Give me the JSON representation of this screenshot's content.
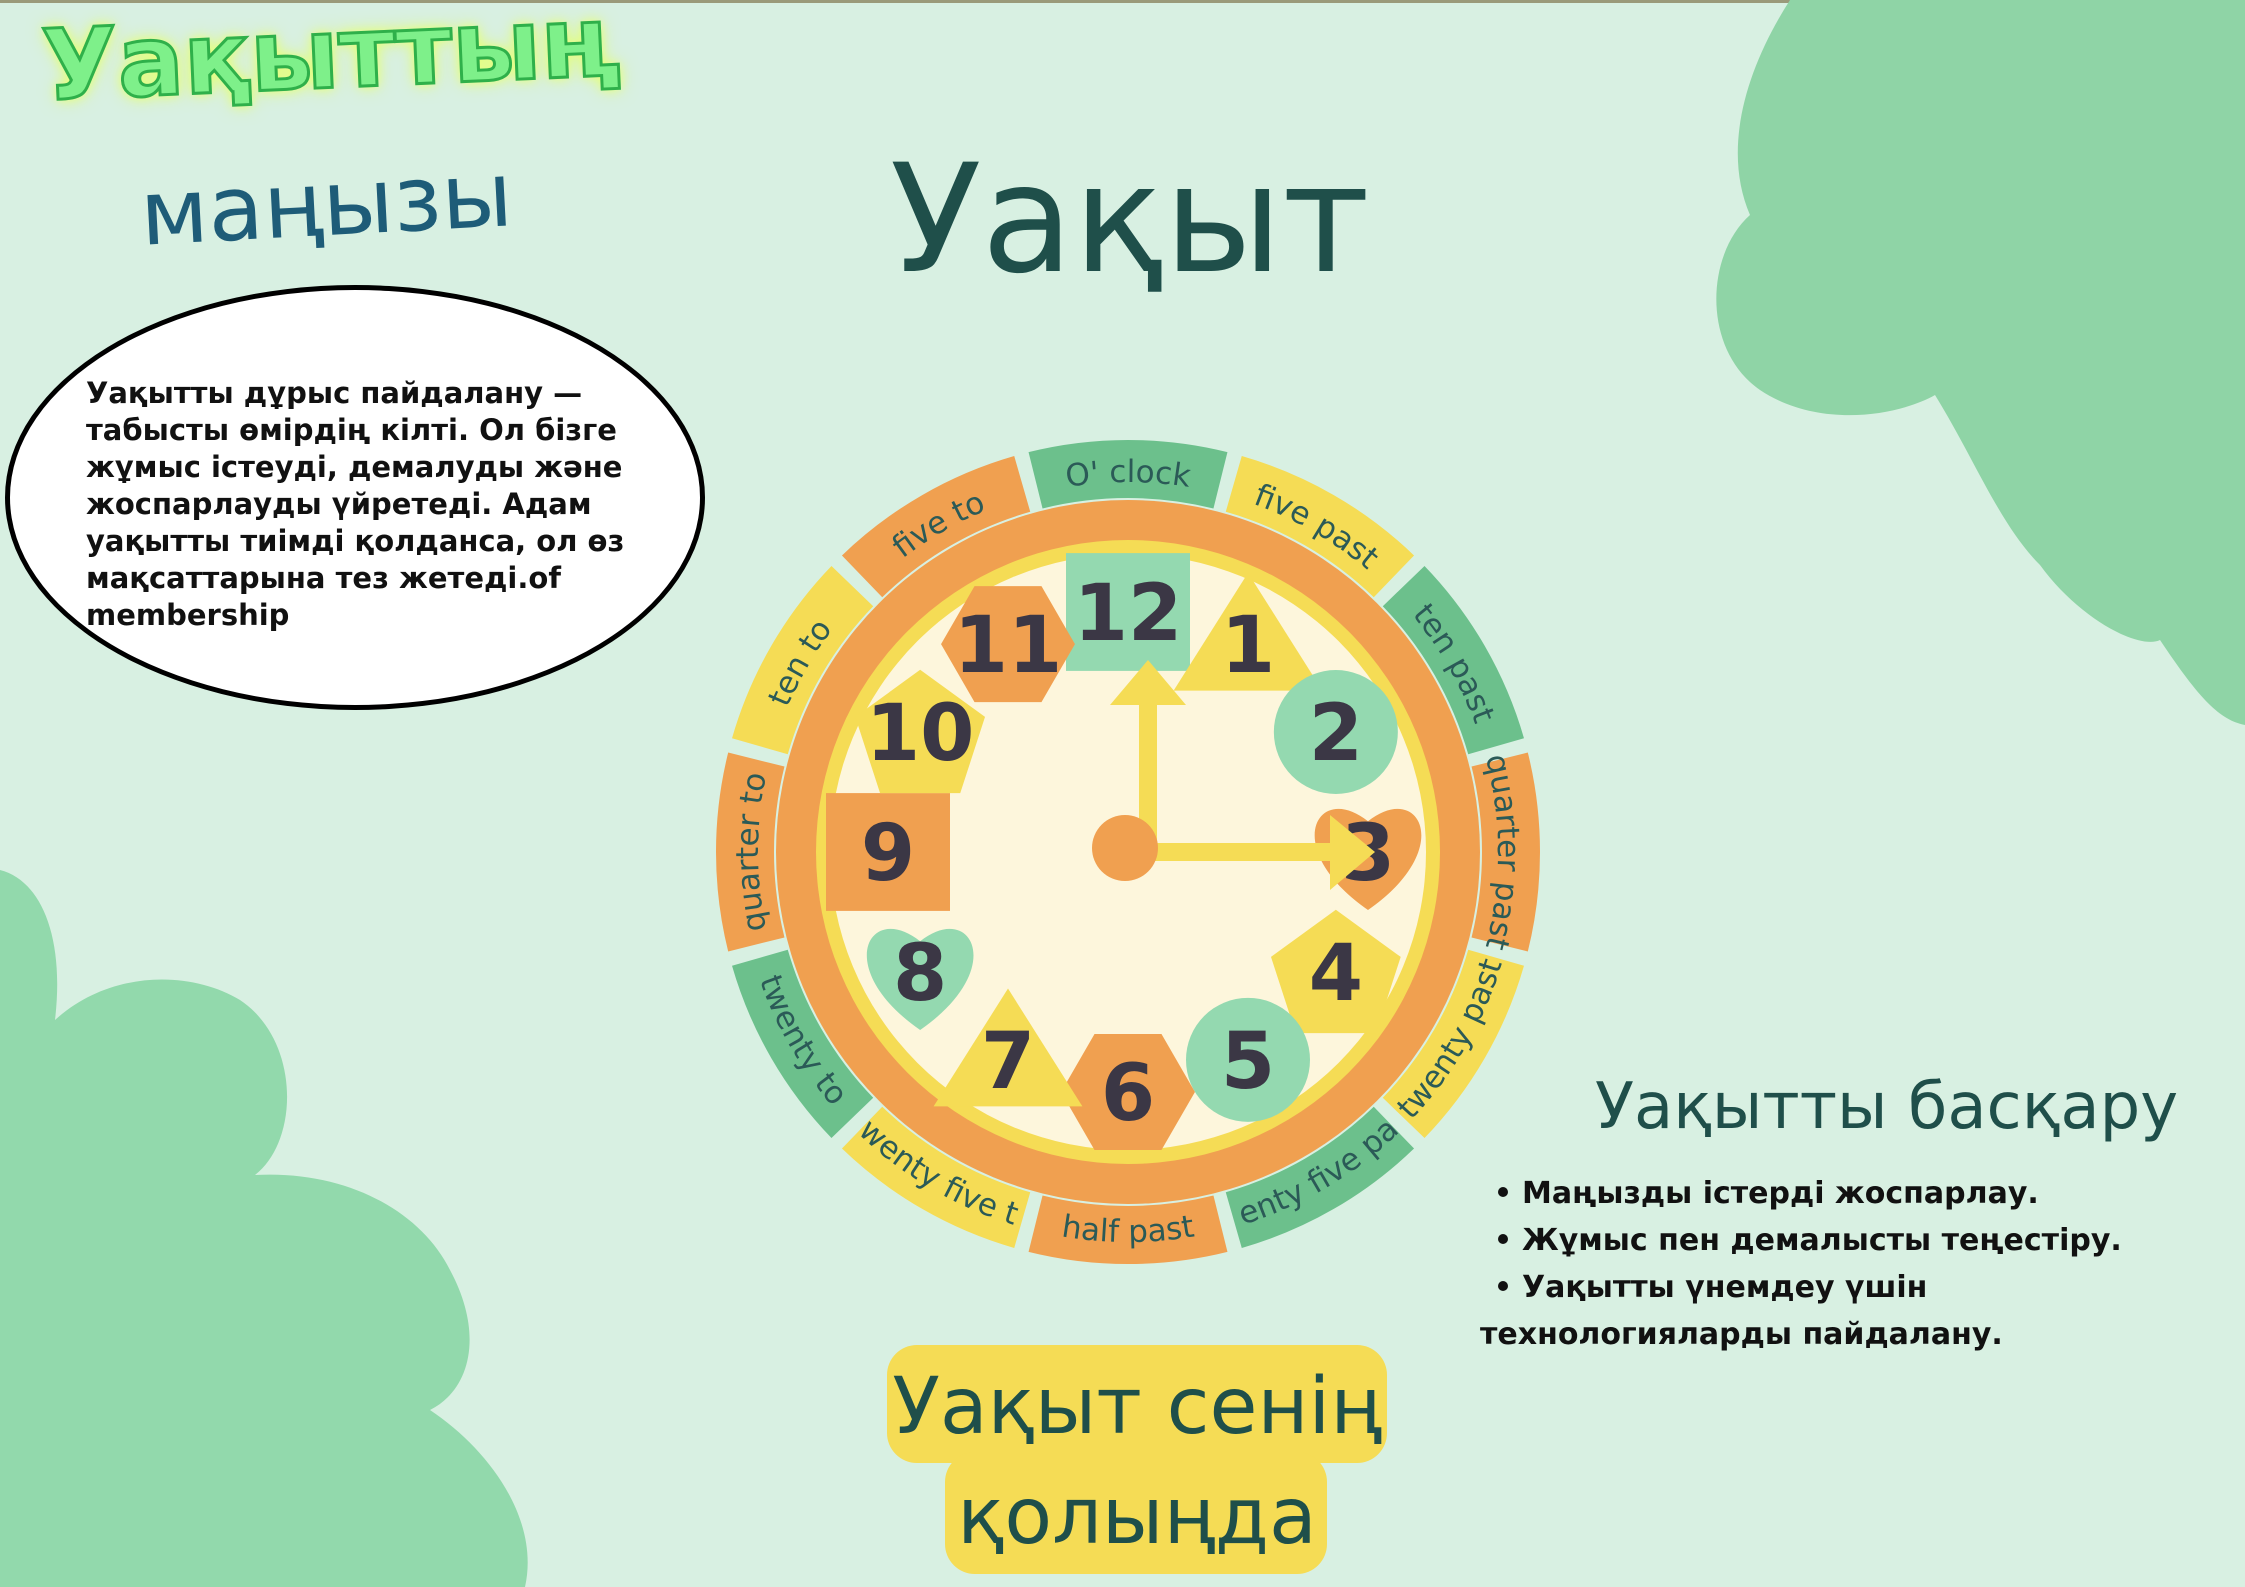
{
  "title": {
    "main": "Уақыттың",
    "sub": "маңызы"
  },
  "heading": "Уақыт",
  "bubble": {
    "text": "Уақытты дұрыс пайдалану — табысты өмірдің кілті. Ол бізге жұмыс істеуді, демалуды және жоспарлауды үйретеді. Адам уақытты тиімді қолданса, ол өз мақсаттарына тез жетеді.of membership"
  },
  "clock": {
    "segments": [
      "O' clock",
      "five past",
      "ten past",
      "quarter past",
      "twenty past",
      "twenty five past",
      "half past",
      "twenty five  to",
      "twenty to",
      "quarter to",
      "ten to",
      "five to"
    ],
    "numbers": [
      "12",
      "1",
      "2",
      "3",
      "4",
      "5",
      "6",
      "7",
      "8",
      "9",
      "10",
      "11"
    ],
    "hour_hand_points_to": 3,
    "minute_hand_points_to": 12
  },
  "management": {
    "heading": "Уақытты басқару",
    "items": [
      "Маңызды істерді жоспарлау.",
      "Жұмыс пен демалысты теңестіру.",
      "Уақытты үнемдеу үшін технологияларды пайдалану."
    ]
  },
  "slogan": {
    "line1": "Уақыт сенің",
    "line2": "қолыңда"
  },
  "colors": {
    "background": "#d8f0e2",
    "leaf": "#8fd4a6",
    "orange": "#f0a050",
    "yellow": "#f5dc55",
    "green": "#6cc08c",
    "mint": "#94d9b0",
    "dial": "#fdf6dc",
    "text_dark": "#1f4f4a"
  }
}
